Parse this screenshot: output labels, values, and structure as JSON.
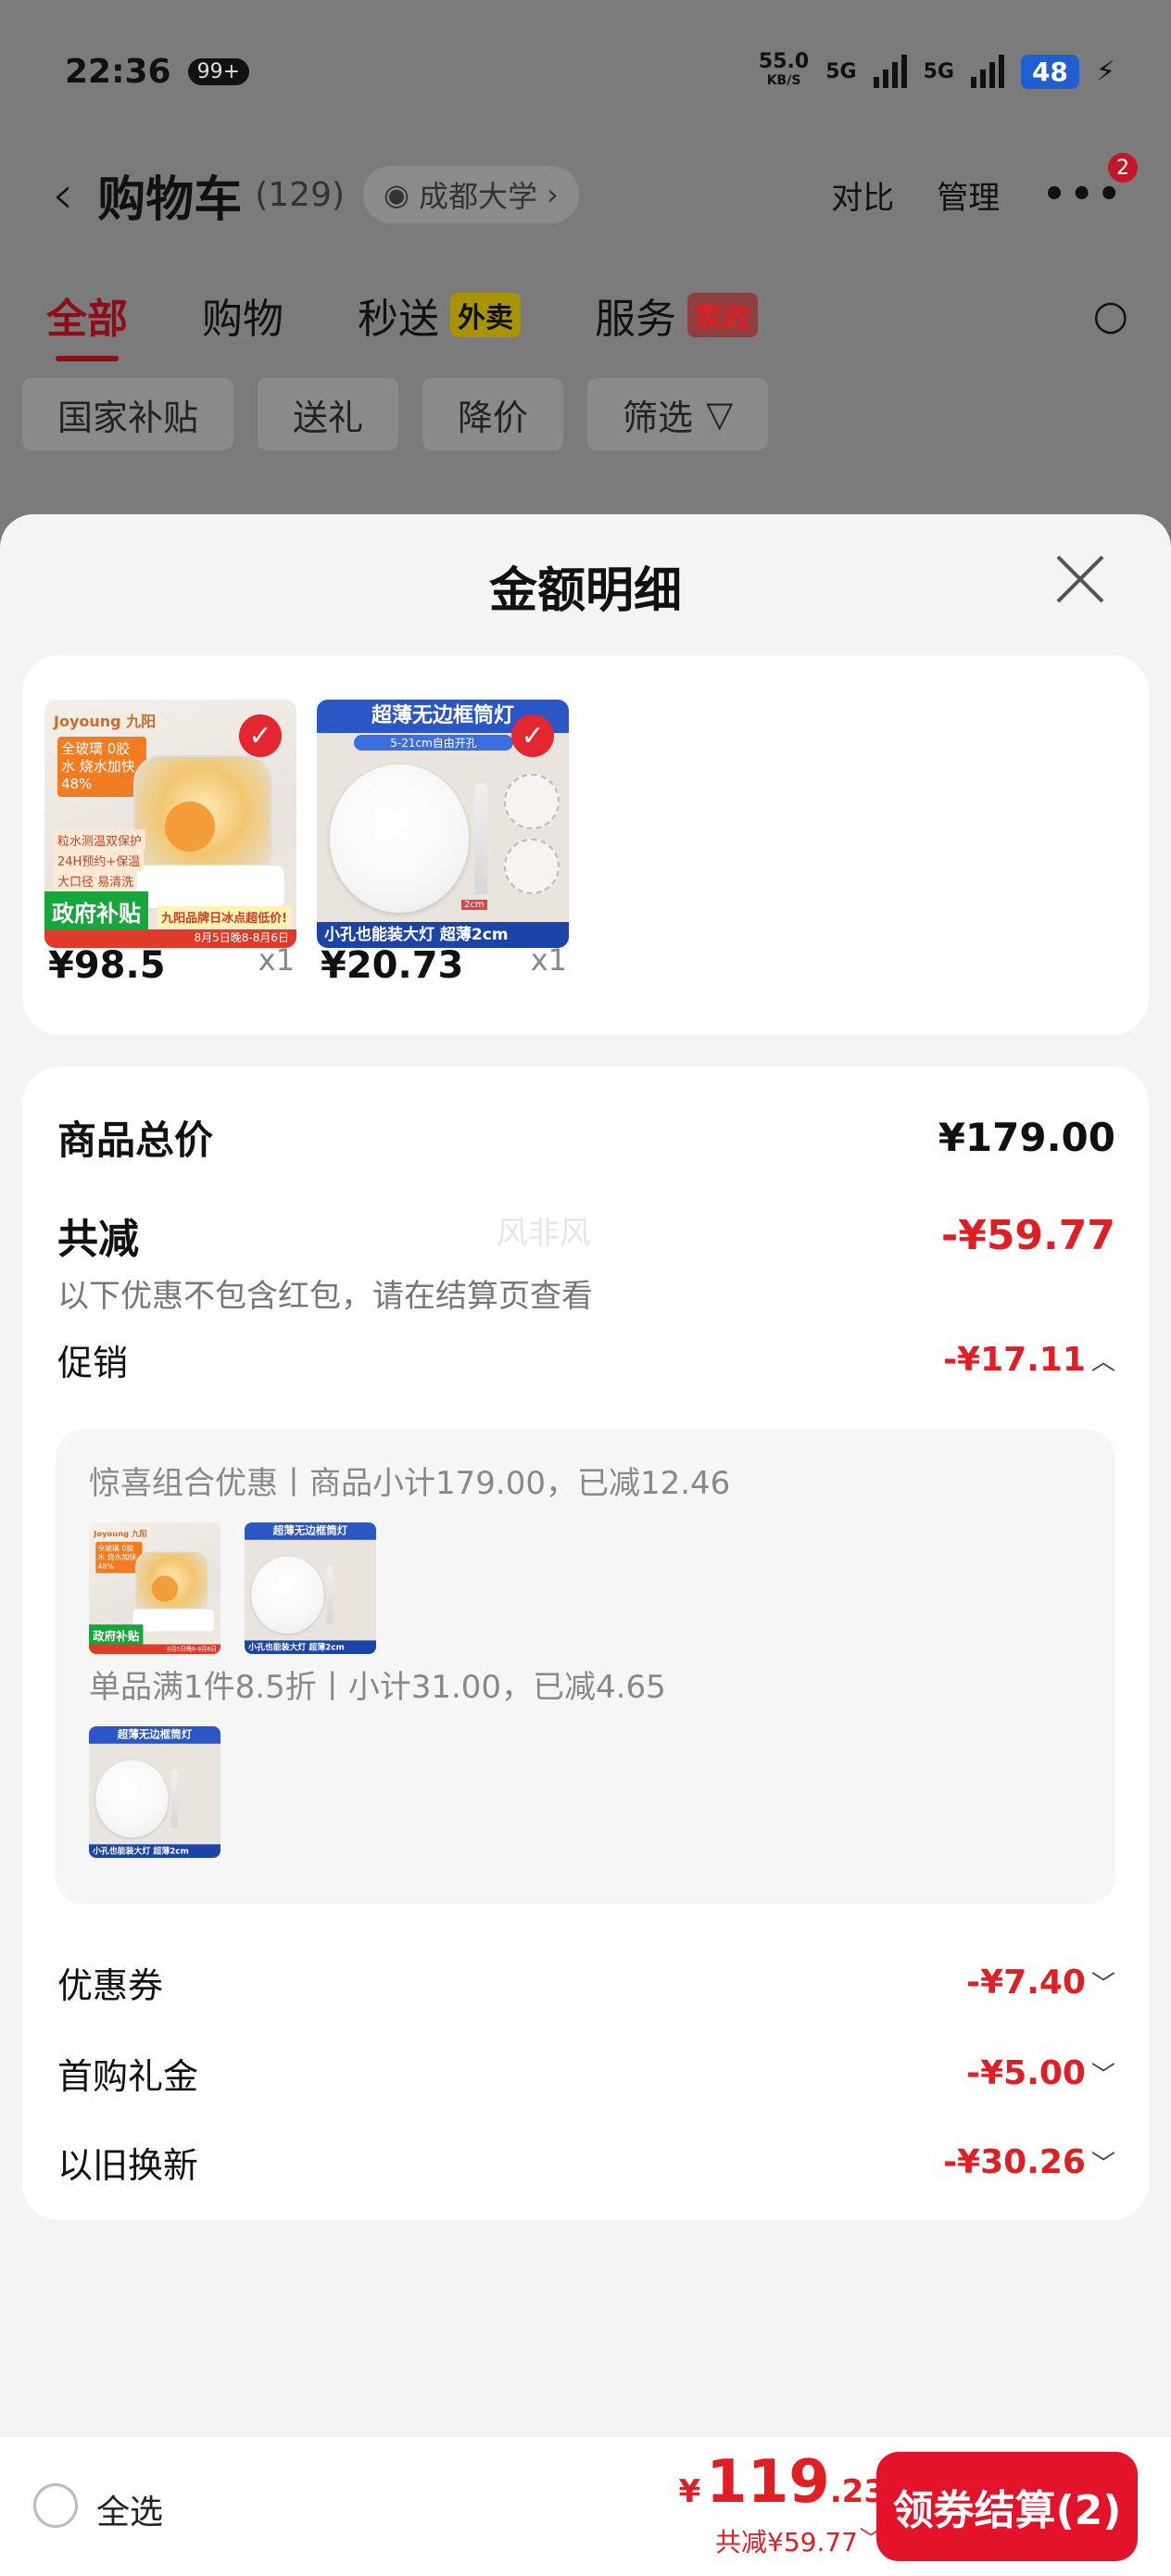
{
  "status_bar": {
    "time": "22:36",
    "notif_badge": "99+",
    "speed_value": "55.0",
    "speed_unit": "KB/S",
    "sig1": "5G",
    "sig2": "5G",
    "battery": "48"
  },
  "navbar": {
    "back_icon": "‹",
    "title": "购物车",
    "count": "(129)",
    "location": "成都大学",
    "compare": "对比",
    "manage": "管理",
    "more_badge": "2"
  },
  "tabs": [
    {
      "label": "全部",
      "tag": ""
    },
    {
      "label": "购物",
      "tag": ""
    },
    {
      "label": "秒送",
      "tag": "外卖"
    },
    {
      "label": "服务",
      "tag": "家政"
    }
  ],
  "chips": [
    "国家补贴",
    "送礼",
    "降价",
    "筛选"
  ],
  "sheet": {
    "title": "金额明细",
    "products": [
      {
        "price": "¥98.5",
        "qty": "x1",
        "img_text": {
          "brand": "Joyoung 九阳",
          "line1": "全玻璃 0胶水 烧水加快48%",
          "bullet1": "粒水测温双保护",
          "bullet2": "24H预约+保温",
          "bullet3": "大口径 易清洗",
          "gov": "政府补贴",
          "promo": "九阳品牌日冰点超低价!",
          "strip": "8月5日晚8-8月6日"
        }
      },
      {
        "price": "¥20.73",
        "qty": "x1",
        "img_text": {
          "head": "超薄无边框筒灯",
          "sub": "5-21cm自由开孔",
          "cm": "2cm",
          "foot": "小孔也能装大灯  超薄2cm"
        }
      }
    ],
    "total_label": "商品总价",
    "total_value": "¥179.00",
    "save_label": "共减",
    "save_value": "-¥59.77",
    "watermark": "风非风",
    "note": "以下优惠不包含红包，请在结算页查看",
    "promo_label": "促销",
    "promo_value": "-¥17.11",
    "promo_lines": [
      "惊喜组合优惠丨商品小计179.00，已减12.46",
      "单品满1件8.5折丨小计31.00，已减4.65"
    ],
    "coupon_label": "优惠券",
    "coupon_value": "-¥7.40",
    "firstbuy_label": "首购礼金",
    "firstbuy_value": "-¥5.00",
    "tradein_label": "以旧换新",
    "tradein_value": "-¥30.26"
  },
  "bottom_bar": {
    "select_all": "全选",
    "currency": "¥",
    "price_int": "119",
    "price_dec": ".23",
    "save_text": "共减¥59.77",
    "pay_button": "领券结算(2)"
  },
  "colors": {
    "accent_red": "#e01f25",
    "button_red": "#e3142a",
    "check_red": "#e3262f",
    "overlay_gray": "#7b7b7b"
  },
  "icons": [
    "back-icon",
    "eye-icon",
    "chevron-right-icon",
    "more-icon",
    "search-icon",
    "filter-icon",
    "close-icon",
    "check-icon",
    "chevron-up-icon",
    "chevron-down-icon",
    "radio-icon"
  ]
}
